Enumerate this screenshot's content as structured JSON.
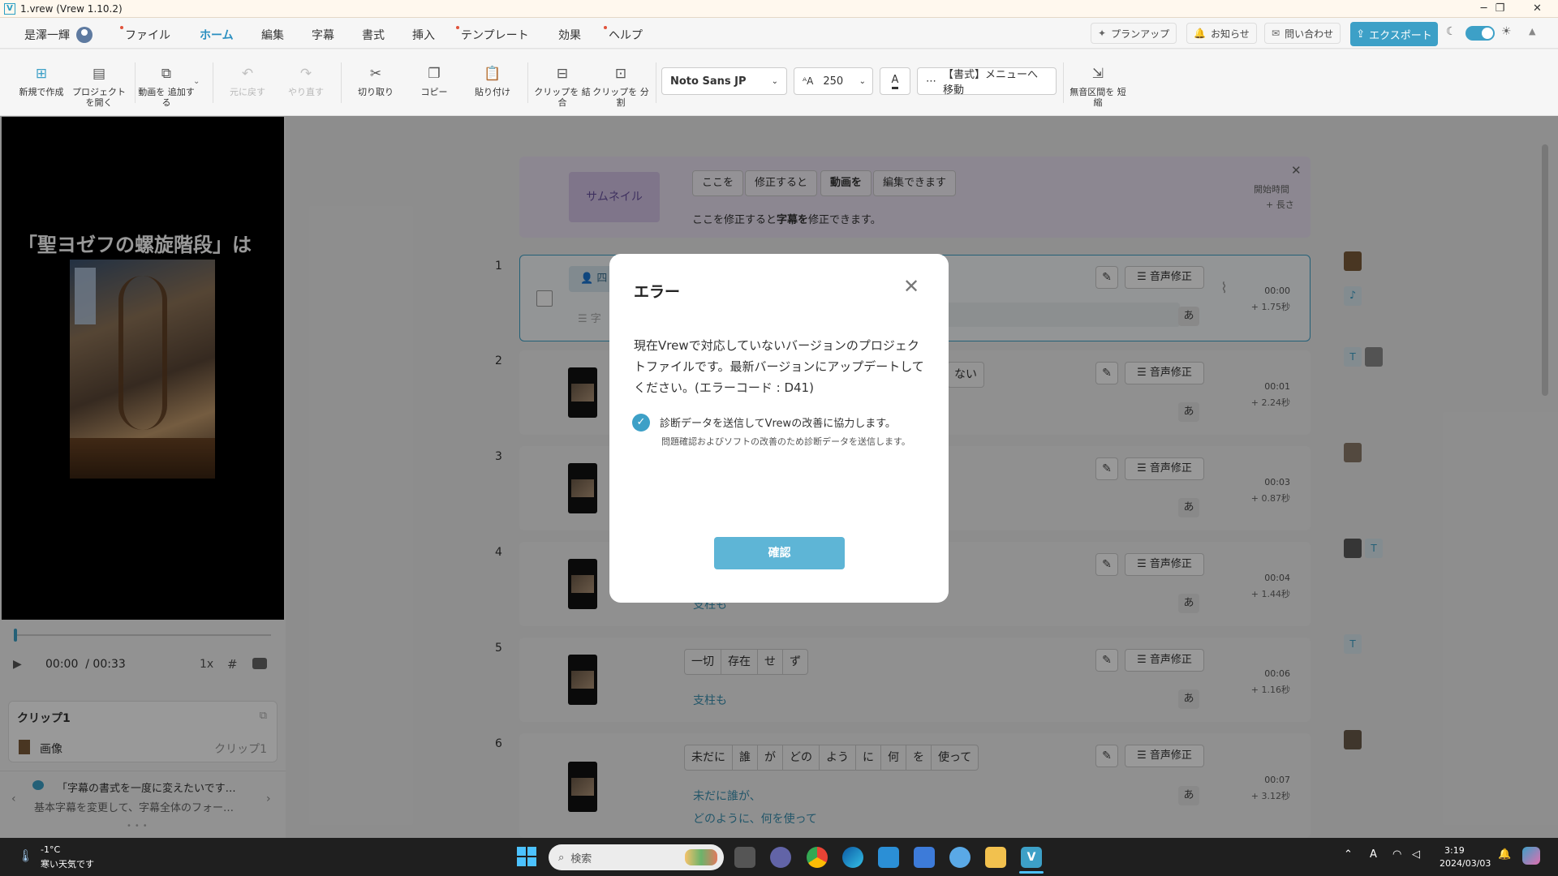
{
  "window": {
    "title": "1.vrew (Vrew 1.10.2)",
    "app_icon": "V",
    "min": "─",
    "max": "❐",
    "close": "✕"
  },
  "menubar": {
    "user": "是澤一輝",
    "items": [
      "ファイル",
      "ホーム",
      "編集",
      "字幕",
      "書式",
      "挿入",
      "テンプレート",
      "効果",
      "ヘルプ"
    ],
    "active": "ホーム",
    "plan": "プランアップ",
    "notice": "お知らせ",
    "contact": "問い合わせ",
    "export": "エクスポート"
  },
  "toolbar": {
    "new_project": "新規で作成",
    "open_project": "プロジェクト を開く",
    "add_video": "動画を 追加する",
    "undo": "元に戻す",
    "redo": "やり直す",
    "cut": "切り取り",
    "copy": "コピー",
    "paste": "貼り付け",
    "merge_clip": "クリップを 結合",
    "split_clip": "クリップを 分割",
    "font": "Noto Sans JP",
    "font_size": "250",
    "format_menu": "【書式】メニューへ移動",
    "shorten_silence": "無音区間を 短縮"
  },
  "preview": {
    "caption": "「聖ヨゼフの螺旋階段」は",
    "time_current": "00:00",
    "time_total": "/ 00:33",
    "speed": "1x"
  },
  "clip_panel": {
    "title": "クリップ1",
    "item": "画像",
    "item_right": "クリップ1"
  },
  "tip": {
    "title": "「字幕の書式を一度に変えたいです…",
    "body": "基本字幕を変更して、字幕全体のフォー…"
  },
  "banner": {
    "thumbnail": "サムネイル",
    "chips": [
      "ここを",
      "修正すると",
      "動画を",
      "編集できます"
    ],
    "desc_a": "ここを修正すると",
    "desc_b": "字幕を",
    "desc_c": "修正できます。",
    "start": "開始時間",
    "length": "+ 長さ"
  },
  "clips": [
    {
      "num": "1",
      "time": "00:00",
      "dur": "+ 1.75秒",
      "frag1": "四",
      "frag2": "字"
    },
    {
      "num": "2",
      "time": "00:01",
      "dur": "+ 2.24秒",
      "frag": "ない"
    },
    {
      "num": "3",
      "time": "00:03",
      "dur": "+ 0.87秒"
    },
    {
      "num": "4",
      "time": "00:04",
      "dur": "+ 1.44秒",
      "sub": "支柱も"
    },
    {
      "num": "5",
      "time": "00:06",
      "dur": "+ 1.16秒",
      "words": [
        "一切",
        "存在",
        "せ",
        "ず"
      ],
      "sub": "支柱も"
    },
    {
      "num": "6",
      "time": "00:07",
      "dur": "+ 3.12秒",
      "words": [
        "未だに",
        "誰",
        "が",
        "どの",
        "よう",
        "に",
        "何",
        "を",
        "使って"
      ],
      "sub1": "未だに誰が、",
      "sub2": "どのように、何を使って"
    }
  ],
  "clip_controls": {
    "voice": "音声修正",
    "a": "あ",
    "pen": "✎"
  },
  "dialog": {
    "title": "エラー",
    "message": "現在Vrewで対応していないバージョンのプロジェクトファイルです。最新バージョンにアップデートしてください。(エラーコード : D41)",
    "checkbox_label": "診断データを送信してVrewの改善に協力します。",
    "checkbox_desc": "問題確認およびソフトの改善のため診断データを送信します。",
    "ok": "確認"
  },
  "taskbar": {
    "temp": "-1°C",
    "weather": "寒い天気です",
    "search": "検索",
    "time": "3:19",
    "date": "2024/03/03",
    "ime": "A"
  }
}
